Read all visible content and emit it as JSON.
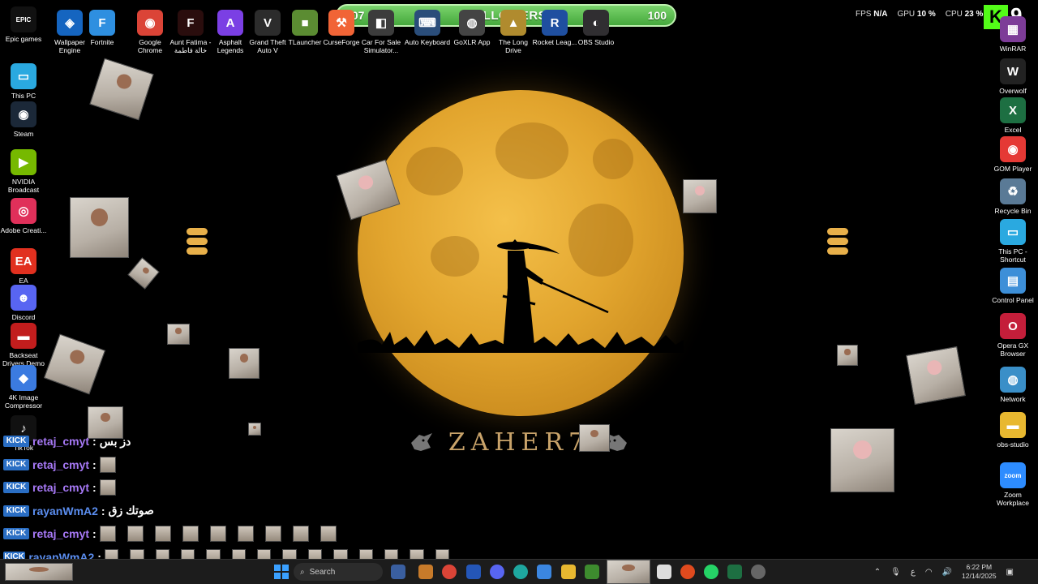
{
  "followers_bar": {
    "current": "107",
    "label": "FOLLOWERS",
    "goal": "100"
  },
  "stats": {
    "fps_label": "FPS",
    "fps_value": "N/A",
    "gpu_label": "GPU",
    "gpu_value": "10 %",
    "cpu_label": "CPU",
    "cpu_value": "23 %"
  },
  "kick": {
    "logo": "K",
    "count": "9"
  },
  "brand": {
    "text": "ZAHER7"
  },
  "desktop_left": [
    {
      "label": "Epic games",
      "icon": "epic-icon",
      "glyph": "EPIC",
      "color": "#111111"
    },
    {
      "label": "This PC",
      "icon": "monitor-icon",
      "glyph": "▭",
      "color": "#2aa9e0"
    },
    {
      "label": "Steam",
      "icon": "steam-icon",
      "glyph": "◉",
      "color": "#1b2838"
    },
    {
      "label": "NVIDIA Broadcast",
      "icon": "nvidia-icon",
      "glyph": "▶",
      "color": "#76b900"
    },
    {
      "label": "Adobe Creati...",
      "icon": "adobe-icon",
      "glyph": "◎",
      "color": "#e0305a"
    },
    {
      "label": "EA",
      "icon": "ea-icon",
      "glyph": "EA",
      "color": "#e1301f"
    },
    {
      "label": "Discord",
      "icon": "discord-icon",
      "glyph": "☻",
      "color": "#5865f2"
    },
    {
      "label": "Backseat Drivers Demo",
      "icon": "car-icon",
      "glyph": "▬",
      "color": "#c21d1d"
    },
    {
      "label": "4K Image Compressor",
      "icon": "compressor-icon",
      "glyph": "◆",
      "color": "#3b7be0"
    },
    {
      "label": "TikTok",
      "icon": "tiktok-icon",
      "glyph": "♪",
      "color": "#111111"
    }
  ],
  "desktop_top": [
    {
      "label": "Wallpaper Engine",
      "icon": "wallpaper-engine-icon",
      "glyph": "◈",
      "color": "#1565c0"
    },
    {
      "label": "Fortnite",
      "icon": "fortnite-icon",
      "glyph": "F",
      "color": "#2e8fe0"
    },
    {
      "label": "Google Chrome",
      "icon": "chrome-icon",
      "glyph": "◉",
      "color": "#db4437"
    },
    {
      "label": "Aunt Fatima - خالة فاطمة",
      "icon": "aunt-fatima-icon",
      "glyph": "F",
      "color": "#2a0d0d"
    },
    {
      "label": "Asphalt Legends",
      "icon": "asphalt-icon",
      "glyph": "A",
      "color": "#7b3fe4"
    },
    {
      "label": "Grand Theft Auto V",
      "icon": "gta-icon",
      "glyph": "V",
      "color": "#2c2c2c"
    },
    {
      "label": "TLauncher",
      "icon": "minecraft-icon",
      "glyph": "■",
      "color": "#5b8c32"
    },
    {
      "label": "CurseForge",
      "icon": "curseforge-icon",
      "glyph": "⚒",
      "color": "#f16436"
    },
    {
      "label": "Car For Sale Simulator...",
      "icon": "car-sale-icon",
      "glyph": "◧",
      "color": "#3c3c3c"
    },
    {
      "label": "Auto Keyboard",
      "icon": "keyboard-icon",
      "glyph": "⌨",
      "color": "#2a4d7a"
    },
    {
      "label": "GoXLR App",
      "icon": "goxlr-icon",
      "glyph": "◍",
      "color": "#444444"
    },
    {
      "label": "The Long Drive",
      "icon": "long-drive-icon",
      "glyph": "▲",
      "color": "#b08b2e"
    },
    {
      "label": "Rocket Leag...",
      "icon": "rocket-league-icon",
      "glyph": "R",
      "color": "#1f4fa0"
    },
    {
      "label": "OBS Studio",
      "icon": "obs-icon",
      "glyph": "◐",
      "color": "#302e31"
    }
  ],
  "desktop_right": [
    {
      "label": "WinRAR",
      "icon": "winrar-icon",
      "glyph": "▦",
      "color": "#7d3c98"
    },
    {
      "label": "Overwolf",
      "icon": "overwolf-icon",
      "glyph": "W",
      "color": "#222222"
    },
    {
      "label": "Excel",
      "icon": "excel-icon",
      "glyph": "X",
      "color": "#1d6f42"
    },
    {
      "label": "GOM Player",
      "icon": "gom-icon",
      "glyph": "◉",
      "color": "#e53935"
    },
    {
      "label": "Recycle Bin",
      "icon": "recycle-bin-icon",
      "glyph": "♻",
      "color": "#5a7a96"
    },
    {
      "label": "This PC - Shortcut",
      "icon": "monitor-icon",
      "glyph": "▭",
      "color": "#2aa9e0"
    },
    {
      "label": "Control Panel",
      "icon": "control-panel-icon",
      "glyph": "▤",
      "color": "#3d8fd8"
    },
    {
      "label": "Opera GX Browser",
      "icon": "opera-gx-icon",
      "glyph": "O",
      "color": "#c41e3a"
    },
    {
      "label": "Network",
      "icon": "network-icon",
      "glyph": "◍",
      "color": "#3a8fc8"
    },
    {
      "label": "obs-studio",
      "icon": "folder-icon",
      "glyph": "▬",
      "color": "#e8b830"
    },
    {
      "label": "Zoom Workplace",
      "icon": "zoom-icon",
      "glyph": "zoom",
      "color": "#2d8cff"
    }
  ],
  "chat": [
    {
      "user": "retaj_cmyt",
      "message": "دز بس",
      "emotes": 0
    },
    {
      "user": "retaj_cmyt",
      "message": "",
      "emotes": 1
    },
    {
      "user": "retaj_cmyt",
      "message": "",
      "emotes": 1
    },
    {
      "user": "rayanWmA2",
      "message": "صوتك زق",
      "emotes": 0
    },
    {
      "user": "retaj_cmyt",
      "message": "",
      "emotes": 9
    },
    {
      "user": "rayanWmA2",
      "message": "",
      "emotes": 14
    }
  ],
  "chat_badge": "KICK",
  "chat_separator": ":",
  "taskbar": {
    "search_placeholder": "Search",
    "time": "6:22 PM",
    "date": "12/14/2025",
    "lang": "ع"
  },
  "colors": {
    "followers_bar": "#45a83c",
    "moon": "#e2a52e",
    "chat_name": "#a678f5",
    "kick": "#53fc18"
  }
}
